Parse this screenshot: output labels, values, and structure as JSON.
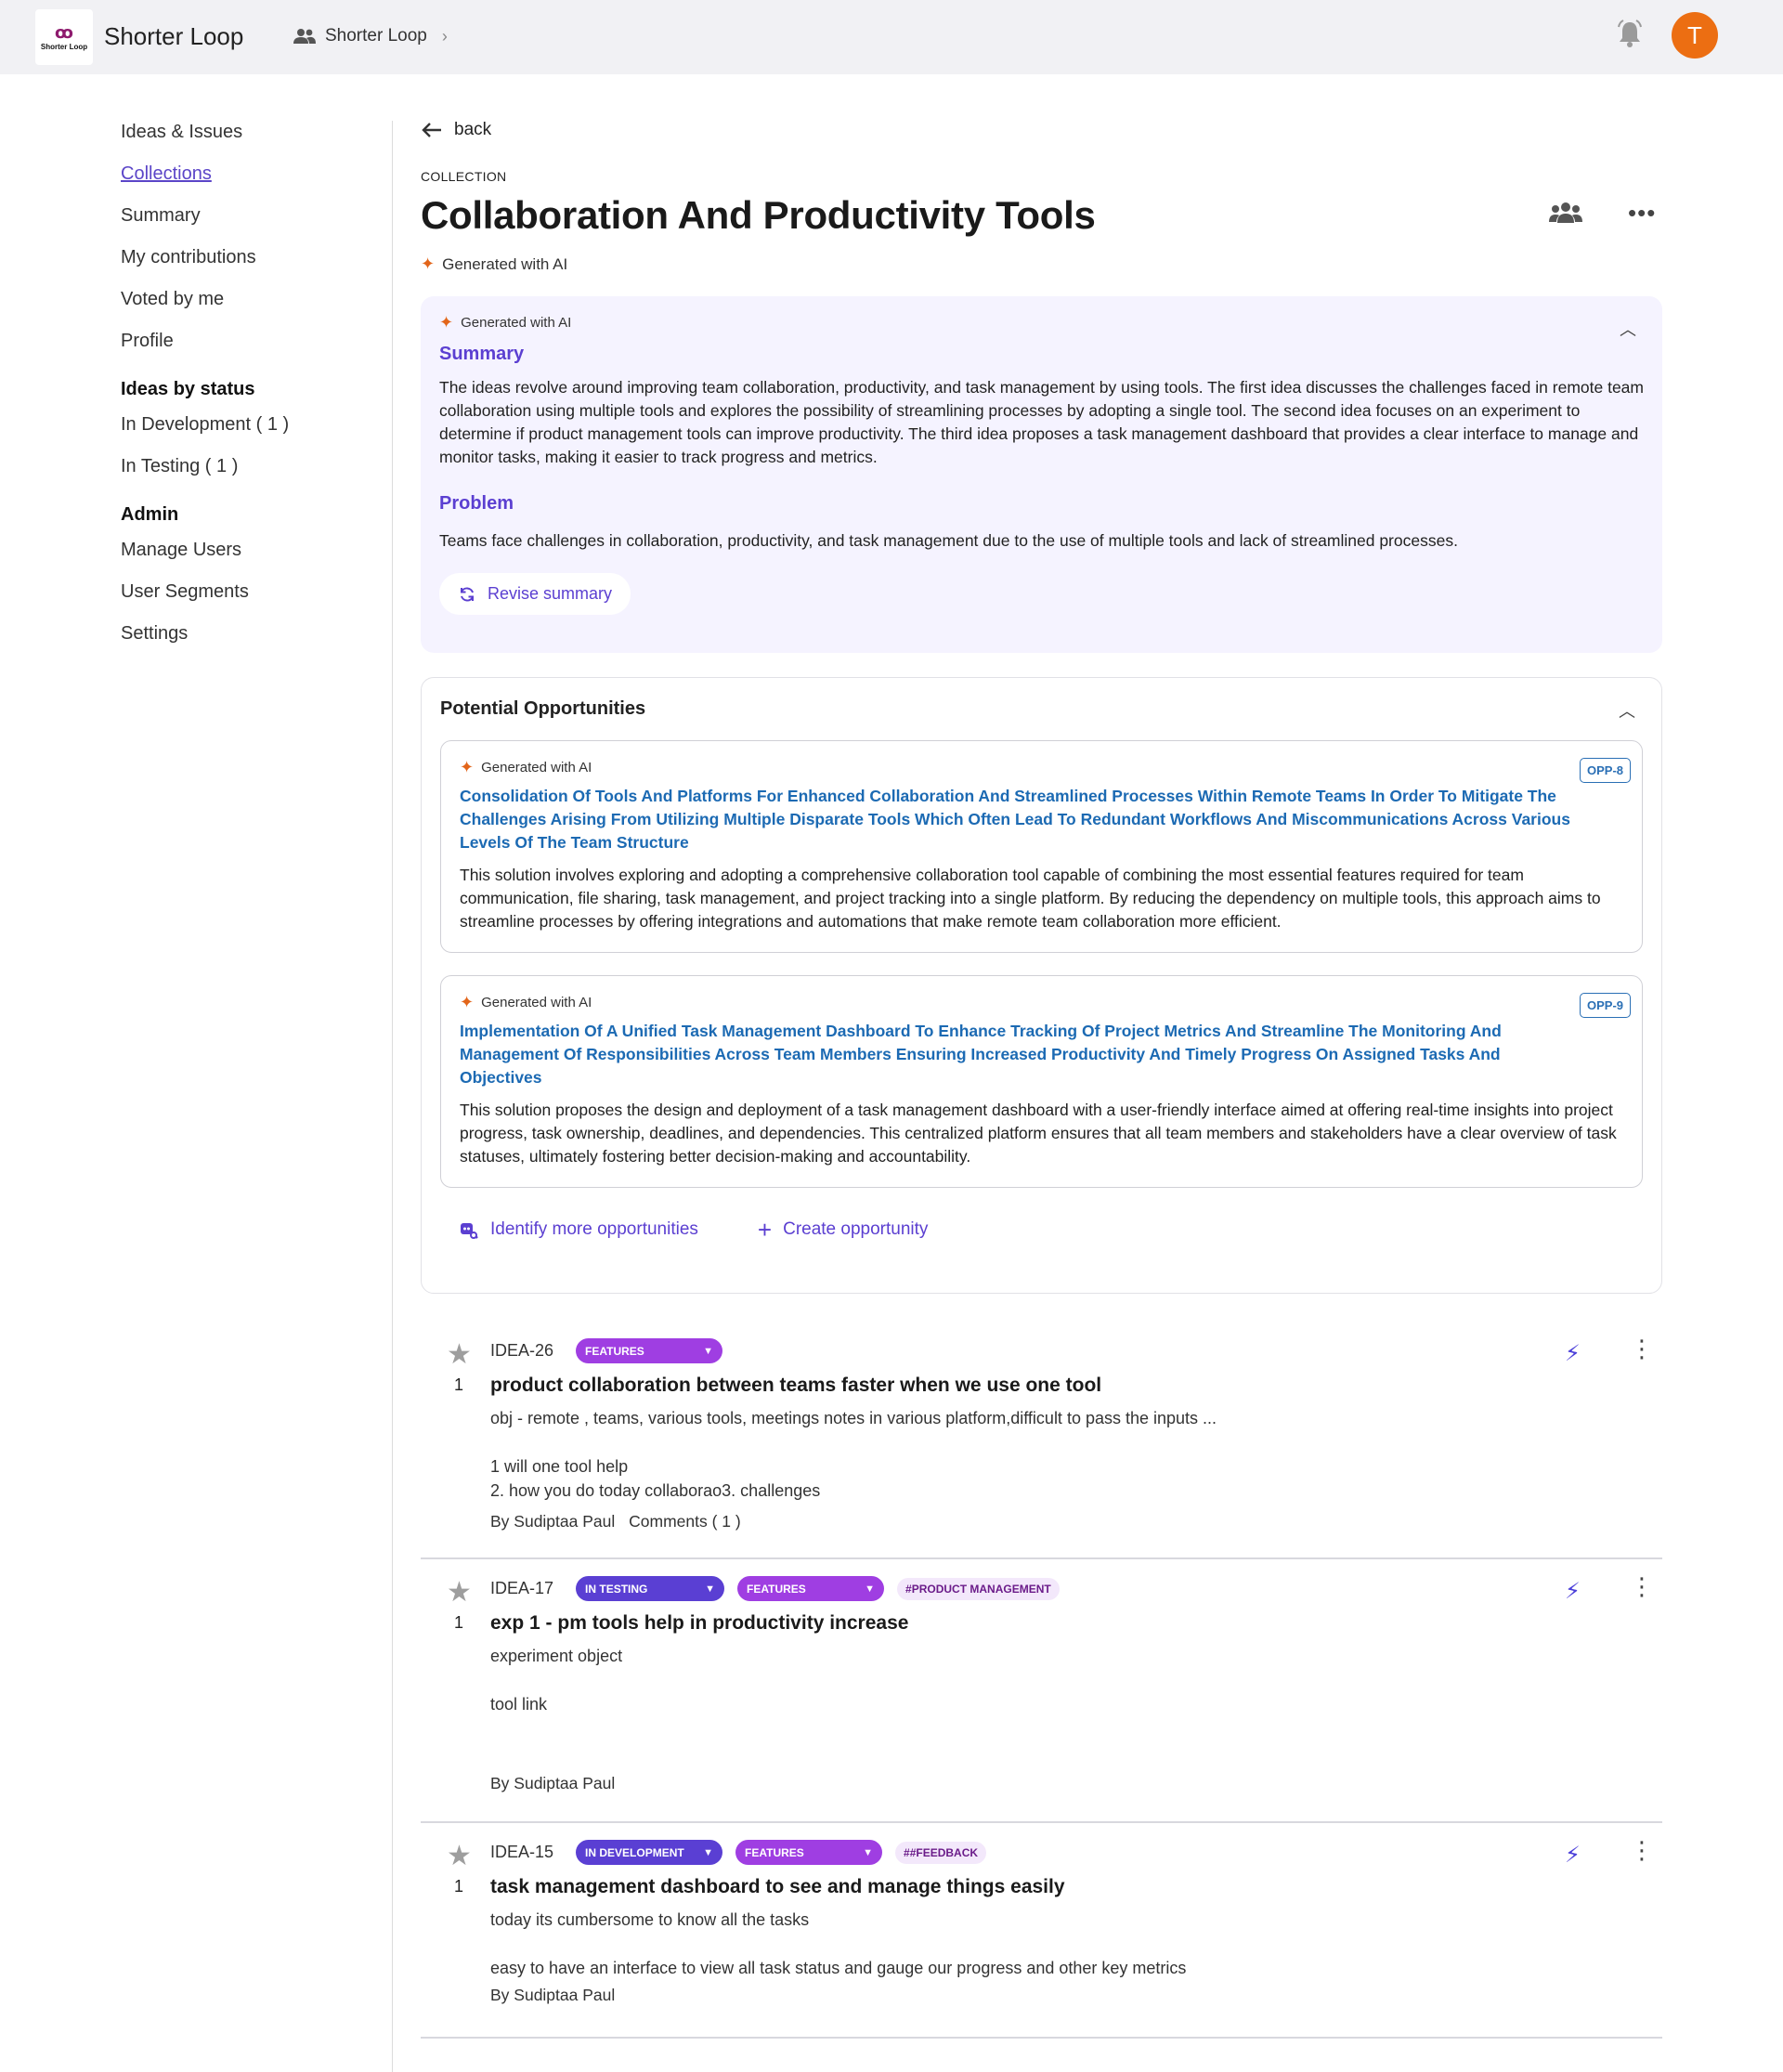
{
  "app": {
    "logo_text": "Shorter Loop",
    "title": "Shorter Loop",
    "breadcrumb": "Shorter Loop",
    "avatar_letter": "T",
    "accent": "#5b3fd1",
    "avatar_color": "#ec6e12"
  },
  "sidebar": {
    "items": [
      "Ideas & Issues",
      "Collections",
      "Summary",
      "My contributions",
      "Voted by me",
      "Profile"
    ],
    "status_heading": "Ideas by status",
    "status_items": [
      "In Development ( 1 )",
      "In Testing ( 1 )"
    ],
    "admin_heading": "Admin",
    "admin_items": [
      "Manage Users",
      "User Segments",
      "Settings"
    ]
  },
  "page": {
    "back": "back",
    "eyebrow": "COLLECTION",
    "title": "Collaboration And Productivity Tools",
    "ai_label": "Generated with AI"
  },
  "summary": {
    "ai_label": "Generated with AI",
    "summary_heading": "Summary",
    "summary_text": "The ideas revolve around improving team collaboration, productivity, and task management by using tools. The first idea discusses the challenges faced in remote team collaboration using multiple tools and explores the possibility of streamlining processes by adopting a single tool. The second idea focuses on an experiment to determine if product management tools can improve productivity. The third idea proposes a task management dashboard that provides a clear interface to manage and monitor tasks, making it easier to track progress and metrics.",
    "problem_heading": "Problem",
    "problem_text": "Teams face challenges in collaboration, productivity, and task management due to the use of multiple tools and lack of streamlined processes.",
    "revise_label": "Revise summary"
  },
  "opportunities": {
    "heading": "Potential Opportunities",
    "items": [
      {
        "ai_label": "Generated with AI",
        "badge": "OPP-8",
        "title": "Consolidation Of Tools And Platforms For Enhanced Collaboration And Streamlined Processes Within Remote Teams In Order To Mitigate The Challenges Arising From Utilizing Multiple Disparate Tools Which Often Lead To Redundant Workflows And Miscommunications Across Various Levels Of The Team Structure",
        "description": "This solution involves exploring and adopting a comprehensive collaboration tool capable of combining the most essential features required for team communication, file sharing, task management, and project tracking into a single platform. By reducing the dependency on multiple tools, this approach aims to streamline processes by offering integrations and automations that make remote team collaboration more efficient."
      },
      {
        "ai_label": "Generated with AI",
        "badge": "OPP-9",
        "title": "Implementation Of A Unified Task Management Dashboard To Enhance Tracking Of Project Metrics And Streamline The Monitoring And Management Of Responsibilities Across Team Members Ensuring Increased Productivity And Timely Progress On Assigned Tasks And Objectives",
        "description": "This solution proposes the design and deployment of a task management dashboard with a user-friendly interface aimed at offering real-time insights into project progress, task ownership, deadlines, and dependencies. This centralized platform ensures that all team members and stakeholders have a clear overview of task statuses, ultimately fostering better decision-making and accountability."
      }
    ],
    "identify_label": "Identify more opportunities",
    "create_label": "Create opportunity"
  },
  "ideas": [
    {
      "key": "IDEA-26",
      "votes": "1",
      "features_tag": "FEATURES",
      "title": "product collaboration between teams faster when we use one tool",
      "line1": "obj - remote , teams, various tools, meetings notes in various platform,difficult to pass the inputs ...",
      "line2": "1 will one tool help",
      "line3": "2. how you do today collaborao3. challenges",
      "author": "By Sudiptaa Paul",
      "comments": "Comments ( 1 )"
    },
    {
      "key": "IDEA-17",
      "votes": "1",
      "status_tag": "IN TESTING",
      "features_tag": "FEATURES",
      "hashtag": "#PRODUCT MANAGEMENT",
      "title": "exp 1 - pm tools help in productivity increase",
      "line1": "experiment object",
      "line2": "tool link",
      "author": "By Sudiptaa Paul"
    },
    {
      "key": "IDEA-15",
      "votes": "1",
      "status_tag": "IN DEVELOPMENT",
      "features_tag": "FEATURES",
      "hashtag": "##FEEDBACK",
      "title": "task management dashboard to see and manage things easily",
      "line1": "today its cumbersome to know all the tasks",
      "line2": "easy to have an interface to view all task status and gauge our progress and other key metrics",
      "author": "By Sudiptaa Paul"
    }
  ]
}
